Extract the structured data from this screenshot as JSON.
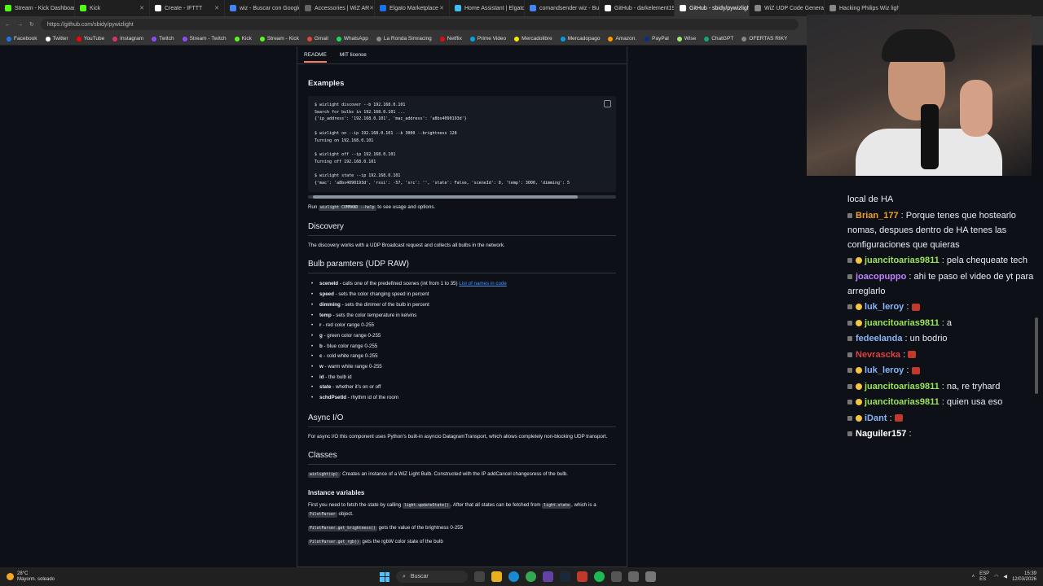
{
  "tabs": [
    {
      "label": "Stream - Kick Dashboard",
      "color": "#53fc18"
    },
    {
      "label": "Kick",
      "color": "#53fc18"
    },
    {
      "label": "Create - IFTTT",
      "color": "#ffffff"
    },
    {
      "label": "wiz - Buscar con Google",
      "color": "#4285f4"
    },
    {
      "label": "Accessories | WiZ AR",
      "color": "#666666"
    },
    {
      "label": "Elgato Marketplace",
      "color": "#1a73e8"
    },
    {
      "label": "Home Assistant | Elgato M",
      "color": "#41bdf5"
    },
    {
      "label": "comandsender wiz - Busc",
      "color": "#4285f4"
    },
    {
      "label": "GitHub - darkelement19/...",
      "color": "#ffffff"
    },
    {
      "label": "GitHub - sbidy/pywizligh",
      "color": "#ffffff",
      "active": true
    },
    {
      "label": "WiZ UDP Code Generator",
      "color": "#888888"
    },
    {
      "label": "Hacking Philips Wiz light",
      "color": "#888888"
    }
  ],
  "url": "https://github.com/sbidy/pywizlight",
  "bookmarks": [
    {
      "label": "Facebook",
      "color": "#1877f2"
    },
    {
      "label": "Twitter",
      "color": "#ffffff"
    },
    {
      "label": "YouTube",
      "color": "#ff0000"
    },
    {
      "label": "Instagram",
      "color": "#e1306c"
    },
    {
      "label": "Twitch",
      "color": "#9146ff"
    },
    {
      "label": "Stream - Twitch",
      "color": "#9146ff"
    },
    {
      "label": "Kick",
      "color": "#53fc18"
    },
    {
      "label": "Stream - Kick",
      "color": "#53fc18"
    },
    {
      "label": "Gmail",
      "color": "#ea4335"
    },
    {
      "label": "WhatsApp",
      "color": "#25d366"
    },
    {
      "label": "La Ronda Simracing",
      "color": "#888888"
    },
    {
      "label": "Netflix",
      "color": "#e50914"
    },
    {
      "label": "Prime Video",
      "color": "#00a8e1"
    },
    {
      "label": "Mercadolibre",
      "color": "#ffe600"
    },
    {
      "label": "Mercadopago",
      "color": "#009ee3"
    },
    {
      "label": "Amazon.",
      "color": "#ff9900"
    },
    {
      "label": "PayPal",
      "color": "#003087"
    },
    {
      "label": "Wise",
      "color": "#9fe870"
    },
    {
      "label": "ChatGPT",
      "color": "#10a37f"
    },
    {
      "label": "OFERTAS RIKY",
      "color": "#888888"
    }
  ],
  "readme_tabs": {
    "readme": "README",
    "license": "MIT license"
  },
  "readme": {
    "examples_heading": "Examples",
    "examples_code": "$ wizlight discover --b 192.168.0.101\nSearch for bulbs in 192.168.0.101 ...\n{'ip_address': '192.168.0.101', 'mac_address': 'a8bs4090193d'}\n\n$ wizlight on --ip 192.168.0.101 --k 3000 --brightness 128\nTurning on 192.168.0.101\n\n$ wizlight off --ip 192.168.0.101\nTurning off 192.168.0.101\n\n$ wizlight state --ip 192.168.0.101\n{'mac': 'a8bs4090193d', 'rssi': -57, 'src': '', 'state': False, 'sceneId': 0, 'temp': 3000, 'dimming': 5",
    "run_pre": "Run",
    "run_code": "wizlight COMMAND --help",
    "run_post": "to see usage and options.",
    "discovery_heading": "Discovery",
    "discovery_text": "The discovery works with a UDP Broadcast request and collects all bulbs in the network.",
    "bulb_heading": "Bulb paramters (UDP RAW)",
    "params": [
      {
        "name": "sceneId",
        "desc": " - calls one of the predefined scenes (int from 1 to 35)",
        "link": "List of names in code"
      },
      {
        "name": "speed",
        "desc": " - sets the color changing speed in percent"
      },
      {
        "name": "dimming",
        "desc": " - sets the dimmer of the bulb in percent"
      },
      {
        "name": "temp",
        "desc": " - sets the color temperature in kelvins"
      },
      {
        "name": "r",
        "desc": " - red color range 0-255"
      },
      {
        "name": "g",
        "desc": " - green color range 0-255"
      },
      {
        "name": "b",
        "desc": " - blue color range 0-255"
      },
      {
        "name": "c",
        "desc": " - cold white range 0-255"
      },
      {
        "name": "w",
        "desc": " - warm white range 0-255"
      },
      {
        "name": "id",
        "desc": " - the bulb id"
      },
      {
        "name": "state",
        "desc": " - whether it's on or off"
      },
      {
        "name": "schdPsetId",
        "desc": " - rhythm id of the room"
      }
    ],
    "async_heading": "Async I/O",
    "async_text": "For async I/O this component uses Python's built-in asyncio DatagramTransport, which allows completely non-blocking UDP transport.",
    "classes_heading": "Classes",
    "classes_code": "wizlight(ip)",
    "classes_text": ": Creates an instance of a WiZ Light Bulb. Constructed with the IP addCancel changesress of the bulb.",
    "instance_heading": "Instance variables",
    "instance_text_pre": "First you need to fetch the state by calling",
    "instance_code1": "light.updateState()",
    "instance_text_mid": ". After that all states can be fetched from",
    "instance_code2": "light.state",
    "instance_text_mid2": ", which is a",
    "instance_code3": "PilotParser",
    "instance_text_post": "object.",
    "pp1_code": "PilotParser.get_brightness()",
    "pp1_text": "gets the value of the brightness 0-255",
    "pp2_code": "PilotParser.get_rgb()",
    "pp2_text": "gets the rgbW color state of the bulb"
  },
  "chat": [
    {
      "user": "",
      "text": "local de HA",
      "color": "#ffffff"
    },
    {
      "user": "Brian_177",
      "text": ": Porque tenes que hostearlo nomas, despues dentro de HA tenes las configuraciones que quieras",
      "color": "#f0a030"
    },
    {
      "user": "juancitoarias9811",
      "text": ": pela chequeate tech",
      "color": "#9be35a",
      "badge": true
    },
    {
      "user": "joacopuppo",
      "text": ": ahi te paso el video de yt para arreglarlo",
      "color": "#c080ff"
    },
    {
      "user": "luk_leroy",
      "text": ":",
      "color": "#8ab4f8",
      "badge": true,
      "emote": true
    },
    {
      "user": "juancitoarias9811",
      "text": ": a",
      "color": "#9be35a",
      "badge": true
    },
    {
      "user": "fedeelanda",
      "text": ": un bodrio",
      "color": "#8ab4f8"
    },
    {
      "user": "Nevrascka",
      "text": ":",
      "color": "#e04040",
      "emote": true
    },
    {
      "user": "luk_leroy",
      "text": ":",
      "color": "#8ab4f8",
      "badge": true,
      "emote": true
    },
    {
      "user": "juancitoarias9811",
      "text": ": na, re tryhard",
      "color": "#9be35a",
      "badge": true
    },
    {
      "user": "juancitoarias9811",
      "text": ": quien usa eso",
      "color": "#9be35a",
      "badge": true
    },
    {
      "user": "iDant",
      "text": ":",
      "color": "#8ab4f8",
      "badge": true,
      "emote": true
    },
    {
      "user": "Naguiler157",
      "text": ":",
      "color": "#ffffff"
    }
  ],
  "taskbar": {
    "weather_temp": "28°C",
    "weather_desc": "Mayorm. soleado",
    "search": "Buscar",
    "lang1": "ESP",
    "lang2": "ES",
    "time": "15:39",
    "date": "12/03/2026"
  }
}
